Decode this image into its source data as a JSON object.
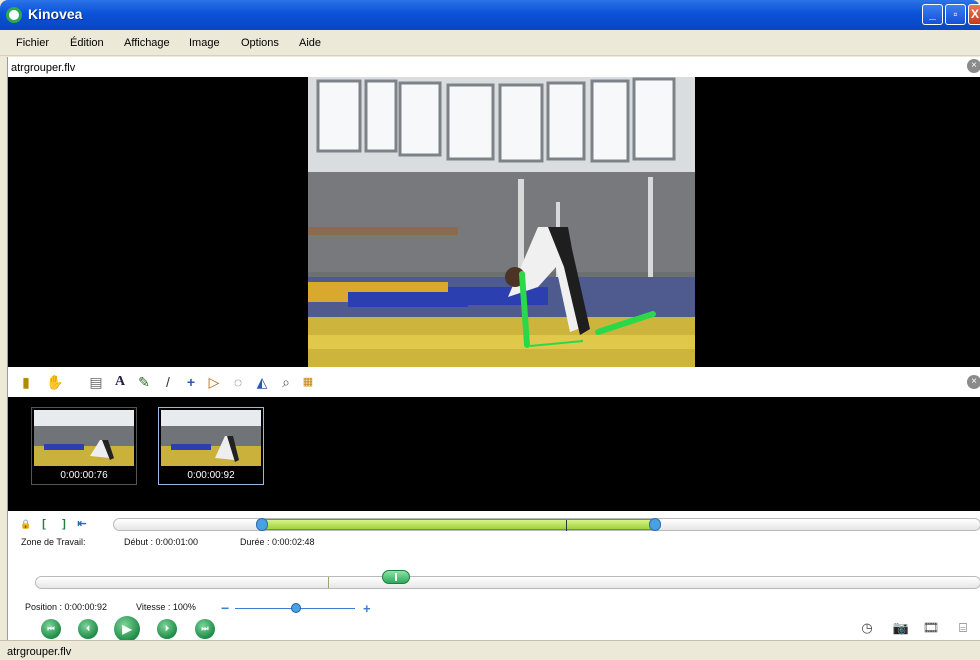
{
  "window": {
    "title": "Kinovea",
    "minimize": "_",
    "maximize": "▫",
    "close": "X"
  },
  "menu": [
    "Fichier",
    "Édition",
    "Affichage",
    "Image",
    "Options",
    "Aide"
  ],
  "screen": {
    "file_name": "atrgrouper.flv",
    "close_glyph": "×"
  },
  "drawing_tools": [
    {
      "name": "add-keyframe-icon",
      "glyph": "▮"
    },
    {
      "name": "hand-icon",
      "glyph": "✋"
    },
    {
      "name": "comment-icon",
      "glyph": "▤"
    },
    {
      "name": "text-icon",
      "glyph": "A"
    },
    {
      "name": "pencil-icon",
      "glyph": "✎"
    },
    {
      "name": "line-icon",
      "glyph": "/"
    },
    {
      "name": "cross-marker-icon",
      "glyph": "+"
    },
    {
      "name": "angle-icon",
      "glyph": "▷"
    },
    {
      "name": "chrono-icon",
      "glyph": "◌"
    },
    {
      "name": "grid-icon",
      "glyph": "◭"
    },
    {
      "name": "magnifier-icon",
      "glyph": "⌕"
    },
    {
      "name": "color-profile-icon",
      "glyph": "▦"
    }
  ],
  "keyframes": [
    {
      "time": "0:00:00:76",
      "selected": false
    },
    {
      "time": "0:00:00:92",
      "selected": true
    }
  ],
  "working_zone": {
    "label": "Zone de Travail:",
    "start": "Début : 0:00:01:00",
    "duration": "Durée : 0:00:02:48",
    "lock_glyph": "🔒",
    "start_glyph": "[",
    "end_glyph": "]",
    "goto_glyph": "⇤"
  },
  "position": {
    "text": "Position : 0:00:00:92"
  },
  "speed": {
    "text": "Vitesse : 100%",
    "minus": "−",
    "plus": "+",
    "value_percent": 100
  },
  "playback": [
    {
      "name": "first-frame-button",
      "glyph": "⏮"
    },
    {
      "name": "previous-frame-button",
      "glyph": "⏴"
    },
    {
      "name": "play-button",
      "glyph": "▶"
    },
    {
      "name": "next-frame-button",
      "glyph": "⏵"
    },
    {
      "name": "last-frame-button",
      "glyph": "⏭"
    }
  ],
  "right_tools": [
    {
      "name": "timer-icon",
      "glyph": "◷"
    },
    {
      "name": "snapshot-icon",
      "glyph": "📷"
    },
    {
      "name": "video-export-icon",
      "glyph": "🎞"
    },
    {
      "name": "presentation-icon",
      "glyph": "⌸"
    }
  ],
  "status": {
    "text": "atrgrouper.flv"
  }
}
